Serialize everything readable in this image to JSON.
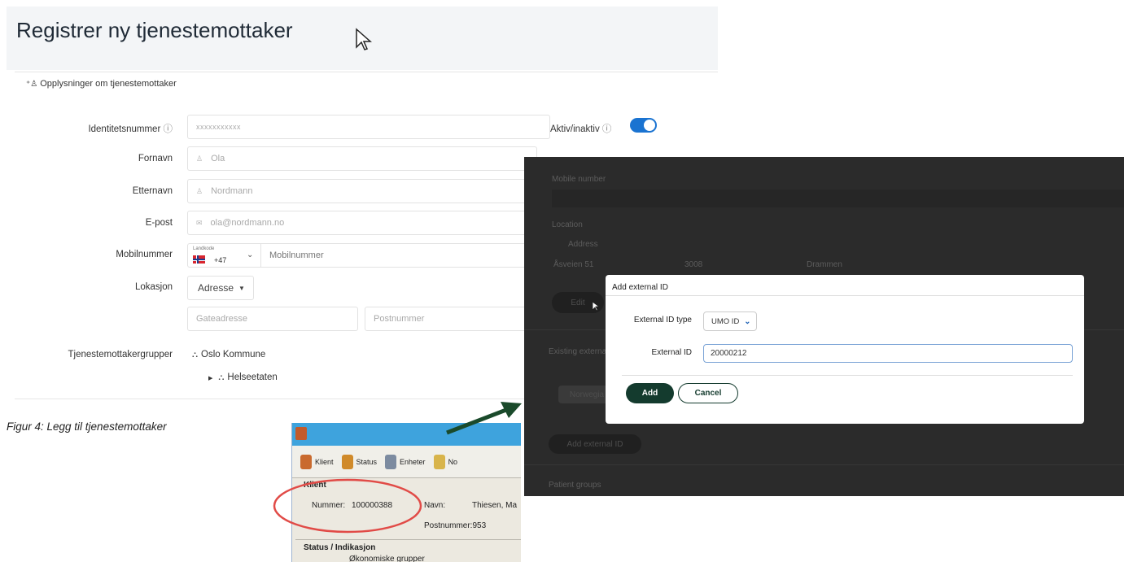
{
  "form": {
    "title": "Registrer ny tjenestemottaker",
    "section": "Opplysninger om tjenestemottaker",
    "fields": {
      "identitet": {
        "label": "Identitetsnummer",
        "placeholder": "xxxxxxxxxxx"
      },
      "fornavn": {
        "label": "Fornavn",
        "placeholder": "Ola"
      },
      "etternavn": {
        "label": "Etternavn",
        "placeholder": "Nordmann"
      },
      "epost": {
        "label": "E-post",
        "placeholder": "ola@nordmann.no"
      },
      "mobil": {
        "label": "Mobilnummer",
        "landcode_label": "Landkode",
        "landcode_value": "+47",
        "placeholder": "Mobilnummer"
      },
      "lokasjon": {
        "label": "Lokasjon",
        "select_value": "Adresse",
        "gate_placeholder": "Gateadresse",
        "post_placeholder": "Postnummer"
      },
      "grupper": {
        "label": "Tjenestemottakergrupper",
        "root": "Oslo Kommune",
        "child": "Helseetaten"
      }
    },
    "active_label": "Aktiv/inaktiv",
    "active_on": true
  },
  "caption": "Figur 4: Legg til tjenestemottaker",
  "dark_panel": {
    "mobile_label": "Mobile number",
    "location_label": "Location",
    "address_select": "Address",
    "street": "Åsveien 51",
    "postal": "3008",
    "city": "Drammen",
    "edit_button": "Edit",
    "existing_label": "Existing externa",
    "chip": "Norwegia",
    "add_external_button": "Add external ID",
    "patient_groups": "Patient groups"
  },
  "modal": {
    "title": "Add external ID",
    "type_label": "External ID type",
    "type_value": "UMO ID",
    "id_label": "External ID",
    "id_value": "20000212",
    "add_button": "Add",
    "cancel_button": "Cancel"
  },
  "legacy": {
    "toolbar": [
      "Klient",
      "Status",
      "Enheter",
      "No"
    ],
    "section": "Klient",
    "nummer_label": "Nummer:",
    "nummer_value": "100000388",
    "navn_label": "Navn:",
    "navn_value": "Thiesen, Ma",
    "postnummer": "Postnummer:953",
    "status_section": "Status / Indikasjon",
    "status_sub": "Økonomiske grupper"
  },
  "colors": {
    "toggle": "#1a73d1",
    "primary_button": "#143b2e",
    "arrow": "#1a4a2b",
    "highlight_ring": "#e14b47"
  }
}
